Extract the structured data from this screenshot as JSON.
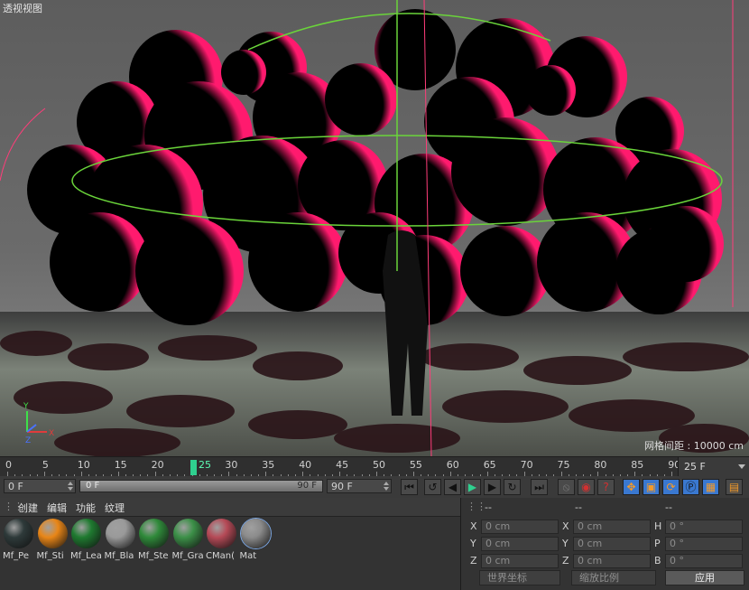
{
  "viewport": {
    "title": "透视视图",
    "grid_spacing": "网格间距 : 10000 cm",
    "axis_labels": {
      "y": "Y",
      "z": "Z",
      "x": "X"
    }
  },
  "timeline": {
    "ticks": [
      "0",
      "5",
      "10",
      "15",
      "20",
      "25",
      "30",
      "35",
      "40",
      "45",
      "50",
      "55",
      "60",
      "65",
      "70",
      "75",
      "80",
      "85",
      "90"
    ],
    "current_frame": "25",
    "fps": "25 F"
  },
  "transport": {
    "start_field": "0 F",
    "range_start": "0 F",
    "range_end": "90 F",
    "end_field": "90 F"
  },
  "materials": {
    "menu": [
      "创建",
      "编辑",
      "功能",
      "纹理"
    ],
    "items": [
      {
        "name": "Mf_Pe",
        "color": "#2e3a3a"
      },
      {
        "name": "Mf_Sti",
        "color": "#e98617"
      },
      {
        "name": "Mf_Lea",
        "color": "#1f7a30"
      },
      {
        "name": "Mf_Bla",
        "color": "#9a9a9a"
      },
      {
        "name": "Mf_Ste",
        "color": "#2f8a3a"
      },
      {
        "name": "Mf_Gra",
        "color": "#3c9048"
      },
      {
        "name": "CMan(",
        "color": "#b64a57"
      },
      {
        "name": "Mat",
        "color": "#8b8b8b"
      }
    ]
  },
  "coords": {
    "headers": [
      "--",
      "--",
      "--"
    ],
    "rows": [
      {
        "a": "X",
        "av": "0 cm",
        "b": "X",
        "bv": "0 cm",
        "c": "H",
        "cv": "0 °"
      },
      {
        "a": "Y",
        "av": "0 cm",
        "b": "Y",
        "bv": "0 cm",
        "c": "P",
        "cv": "0 °"
      },
      {
        "a": "Z",
        "av": "0 cm",
        "b": "Z",
        "bv": "0 cm",
        "c": "B",
        "cv": "0 °"
      }
    ],
    "world_dropdown": "世界坐标",
    "scale_dropdown": "缩放比例",
    "apply": "应用"
  },
  "colors": {
    "accent_green": "#5dfbb2",
    "sphere_rim": "#ff1a6e",
    "spline_green": "#6ad43a",
    "selection_blue": "#3a78d0"
  }
}
